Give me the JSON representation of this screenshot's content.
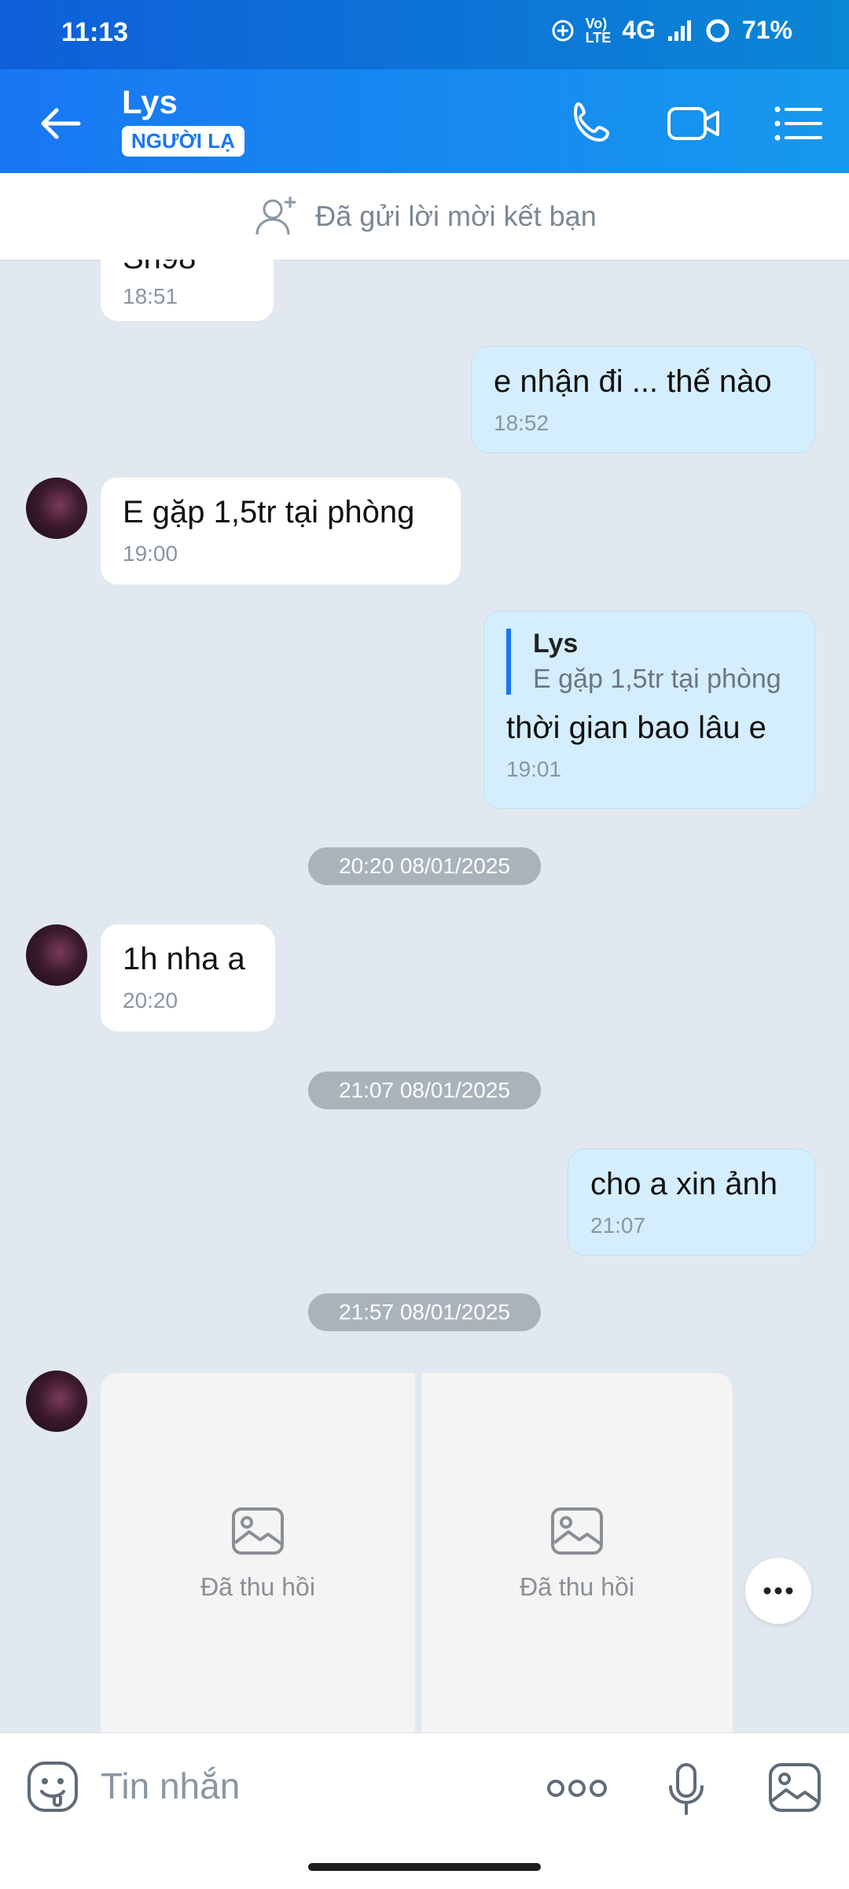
{
  "status": {
    "time": "11:13",
    "network": "4G",
    "battery": "71%"
  },
  "header": {
    "name": "Lys",
    "badge": "NGƯỜI LẠ"
  },
  "friend_notice": "Đã gửi lời mời kết bạn",
  "messages": [
    {
      "partial_text": "Sh98",
      "time": "18:51"
    },
    {
      "text": "e nhận đi ... thế nào",
      "time": "18:52"
    },
    {
      "text": "E gặp 1,5tr tại phòng",
      "time": "19:00"
    },
    {
      "quote_name": "Lys",
      "quote_text": "E gặp 1,5tr tại phòng",
      "text": "thời gian bao lâu e",
      "time": "19:01"
    },
    {
      "text": "1h nha a",
      "time": "20:20"
    },
    {
      "text": "cho a xin ảnh",
      "time": "21:07"
    }
  ],
  "dates": [
    "20:20 08/01/2025",
    "21:07 08/01/2025",
    "21:57 08/01/2025"
  ],
  "recalled_label": "Đã thu hồi",
  "input": {
    "placeholder": "Tin nhắn"
  },
  "icons": [
    "back-arrow-icon",
    "phone-icon",
    "video-icon",
    "menu-icon",
    "add-friend-icon",
    "emoji-icon",
    "more-dots-icon",
    "mic-icon",
    "image-icon"
  ],
  "colors": {
    "header": "#1877f2",
    "out_bubble": "#d5eefe",
    "chat_bg": "#e2e8f0"
  }
}
